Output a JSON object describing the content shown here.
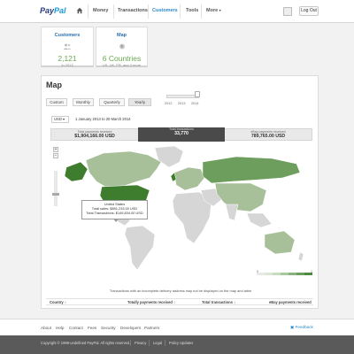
{
  "brand": {
    "pay": "Pay",
    "pal": "Pal"
  },
  "nav": [
    "Money",
    "Transactions",
    "Customers",
    "Tools",
    "More"
  ],
  "nav_more_caret": "▾",
  "logout_label": "Log Out",
  "cards": [
    {
      "title": "Customers",
      "value": "2,121",
      "sub": "in 2013"
    },
    {
      "title": "Map",
      "value": "6 Countries",
      "sub": "US, UK, FR, and 3 more"
    }
  ],
  "panel": {
    "title": "Map",
    "segments": [
      "Custom",
      "Monthly",
      "Quarterly",
      "Yearly"
    ],
    "active_segment": "Yearly",
    "years": [
      "2012",
      "2013",
      "2014"
    ],
    "currency": "USD",
    "currency_caret": "▾",
    "date_range": "1 January 2014  to  20 March 2014",
    "stats": [
      {
        "label": "Total payments received",
        "value": "$1,904,166.00 USD"
      },
      {
        "label": "Total transactions",
        "value": "33,770"
      },
      {
        "label": "eBay payments received",
        "value": "789,765.00 USD"
      }
    ],
    "zoom_in": "+",
    "zoom_out": "−",
    "tooltip": {
      "title": "United States",
      "line1": "Total sales:  $891,233.00 USD",
      "line2": "Total Transactions:  $149,834.00 USD"
    },
    "legend_min": "0",
    "legend_max": "1",
    "legend_colors": [
      "#e9e9e9",
      "#d9e7d4",
      "#c6dcbd",
      "#a8c99c",
      "#88b37a",
      "#6e9e5e",
      "#4e8a3e"
    ],
    "note": "Transactions with an incomplete delivery address may not be displayed on the map and table",
    "columns": [
      "Country",
      "Totally payments received",
      "Total transactions",
      "eBay payments received"
    ],
    "column_caret": "↕"
  },
  "footer": {
    "links": [
      "About",
      "Help",
      "Contact",
      "Fees",
      "Security",
      "Developers",
      "Partners"
    ],
    "feedback": "Feedback",
    "copyright": "Copyright © 1999-undefined PayPal. All rights reserved.",
    "legal": [
      "Privacy",
      "Legal",
      "Policy Updates"
    ]
  },
  "colors": {
    "accent": "#2a8bcb",
    "map_us": "#3f7d2e",
    "map_active": "#a8c09a",
    "map_inactive": "#d6d6d6",
    "stats_active": "#4a4a4a"
  }
}
